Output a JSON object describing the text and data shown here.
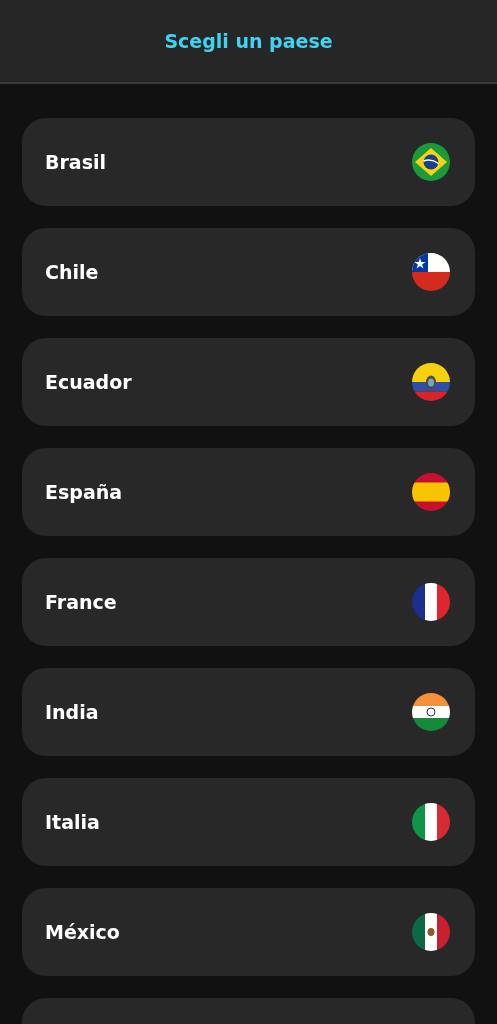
{
  "header": {
    "title": "Scegli un paese"
  },
  "countries": [
    {
      "kind": "br",
      "label": "Brasil"
    },
    {
      "kind": "cl",
      "label": "Chile"
    },
    {
      "kind": "ec",
      "label": "Ecuador"
    },
    {
      "kind": "es",
      "label": "España"
    },
    {
      "kind": "fr",
      "label": "France"
    },
    {
      "kind": "in",
      "label": "India"
    },
    {
      "kind": "it",
      "label": "Italia"
    },
    {
      "kind": "mx",
      "label": "México"
    },
    {
      "kind": "cutoff"
    }
  ]
}
